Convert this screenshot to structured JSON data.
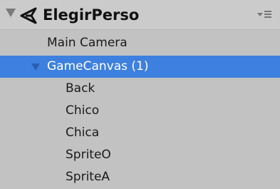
{
  "hierarchy": {
    "scene": {
      "title": "ElegirPerso",
      "icon": "unity-scene-icon"
    },
    "menu_icon": "context-menu-icon",
    "items": [
      {
        "label": "Main Camera",
        "depth": 0,
        "selected": false
      },
      {
        "label": "GameCanvas (1)",
        "depth": 0,
        "selected": true,
        "expanded": true
      },
      {
        "label": "Back",
        "depth": 1,
        "selected": false
      },
      {
        "label": "Chico",
        "depth": 1,
        "selected": false
      },
      {
        "label": "Chica",
        "depth": 1,
        "selected": false
      },
      {
        "label": "SpriteO",
        "depth": 1,
        "selected": false
      },
      {
        "label": "SpriteA",
        "depth": 1,
        "selected": false
      }
    ]
  },
  "colors": {
    "background": "#c2c2c2",
    "selection": "#3d80df",
    "text": "#1a1a1a",
    "selected_text": "#ffffff"
  }
}
